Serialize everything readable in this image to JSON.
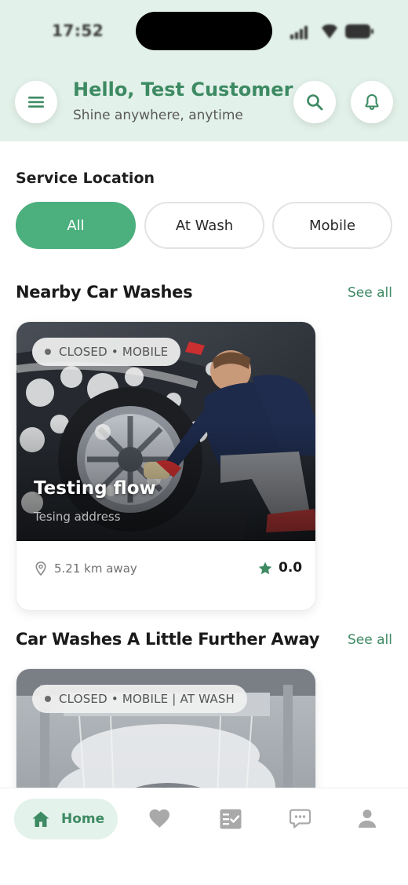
{
  "status_bar": {
    "time": "17:52"
  },
  "header": {
    "greeting": "Hello, Test Customer",
    "subtitle": "Shine anywhere, anytime",
    "menu_icon": "hamburger-menu-icon",
    "search_icon": "search-icon",
    "notification_icon": "bell-icon"
  },
  "service_location": {
    "label": "Service Location",
    "options": [
      {
        "label": "All",
        "selected": true
      },
      {
        "label": "At Wash",
        "selected": false
      },
      {
        "label": "Mobile",
        "selected": false
      }
    ]
  },
  "sections": [
    {
      "title": "Nearby Car Washes",
      "see_all": "See all",
      "cards": [
        {
          "badge": "CLOSED • MOBILE",
          "name": "Testing flow",
          "address": "Tesing address",
          "distance": "5.21 km away",
          "rating": "0.0"
        }
      ]
    },
    {
      "title": "Car Washes A Little Further Away",
      "see_all": "See all",
      "cards": [
        {
          "badge": "CLOSED • MOBILE | AT WASH"
        }
      ]
    }
  ],
  "bottom_nav": {
    "items": [
      {
        "label": "Home",
        "icon": "home-icon",
        "active": true
      },
      {
        "label": "",
        "icon": "heart-icon",
        "active": false
      },
      {
        "label": "",
        "icon": "checklist-icon",
        "active": false
      },
      {
        "label": "",
        "icon": "chat-icon",
        "active": false
      },
      {
        "label": "",
        "icon": "profile-icon",
        "active": false
      }
    ]
  },
  "colors": {
    "brand_green": "#3d8a63",
    "chip_active": "#4caf7e",
    "header_bg": "#e2f1e9"
  }
}
